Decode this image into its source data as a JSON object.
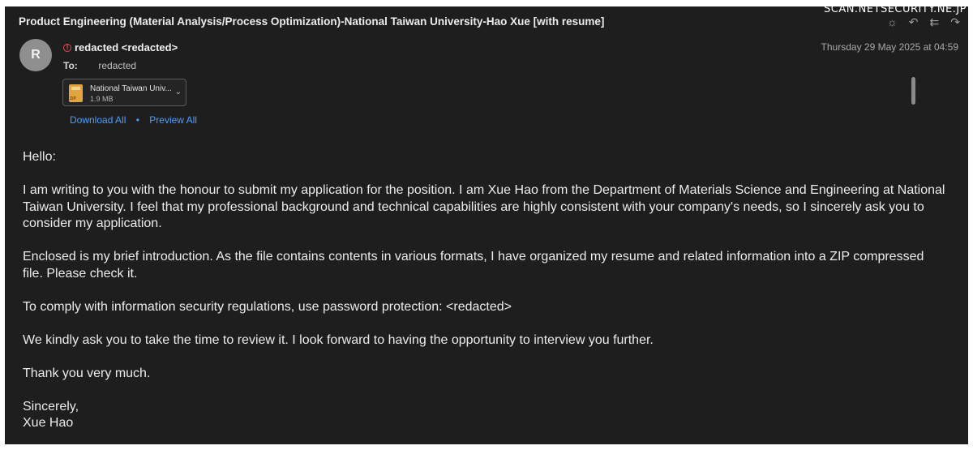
{
  "watermark": "SCAN.NETSECURITY.NE.JP",
  "email": {
    "subject": "Product Engineering (Material Analysis/Process Optimization)-National Taiwan University-Hao Xue [with resume]",
    "avatar_initial": "R",
    "sender": "redacted <redacted>",
    "to_label": "To:",
    "to_value": "redacted",
    "datetime": "Thursday 29 May 2025 at 04:59",
    "toolbar_icons": [
      "sun-icon",
      "reply-icon",
      "reply-all-icon",
      "forward-icon"
    ],
    "attachment": {
      "name": "National Taiwan Univ...",
      "size": "1.9 MB",
      "icon": "zip-file-icon"
    },
    "download_all": "Download All",
    "link_separator": "•",
    "preview_all": "Preview All",
    "body": {
      "greeting": "Hello:",
      "paragraph1": "I am writing to you with the honour to submit my application for the position. I am Xue Hao from the Department of Materials Science and Engineering at National Taiwan University. I feel that my professional background and technical capabilities are highly consistent with your company's needs, so I sincerely ask you to consider my application.",
      "paragraph2": "Enclosed is my brief introduction. As the file contains contents in various formats, I have organized my resume and related information into a ZIP compressed file. Please check it.",
      "paragraph3": "To comply with information security regulations, use password protection: <redacted>",
      "paragraph4": "We kindly ask you to take the time to review it. I look forward to having the opportunity to interview you further.",
      "paragraph5": "Thank you very much.",
      "closing": "Sincerely,",
      "signature": "Xue Hao"
    }
  },
  "colors": {
    "background": "#1e1e1e",
    "text": "#ececec",
    "link": "#4a9fff",
    "warning": "#e5484d",
    "zip": "#e0a440"
  }
}
